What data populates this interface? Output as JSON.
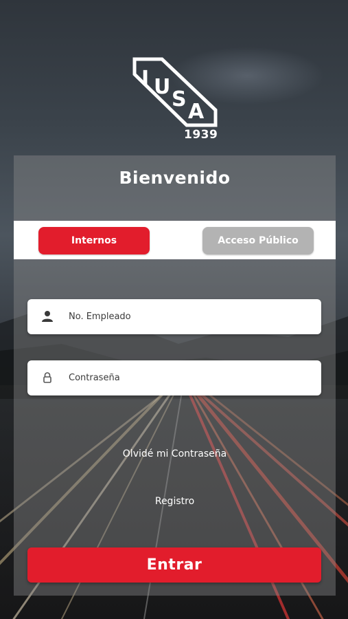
{
  "brand": {
    "logo_text": "IUSA",
    "year": "1939",
    "accent_color": "#e21d2c"
  },
  "welcome_title": "Bienvenido",
  "tabs": [
    {
      "label": "Internos",
      "active": true
    },
    {
      "label": "Acceso Público",
      "active": false
    }
  ],
  "form": {
    "employee_field": {
      "placeholder": "No. Empleado",
      "value": "",
      "icon": "user-icon"
    },
    "password_field": {
      "placeholder": "Contraseña",
      "value": "",
      "icon": "lock-icon"
    },
    "forgot_password_link": "Olvidé mi Contraseña",
    "register_link": "Registro",
    "submit_label": "Entrar"
  }
}
